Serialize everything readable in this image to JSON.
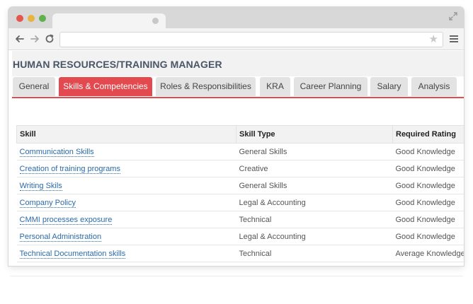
{
  "page": {
    "title": "HUMAN RESOURCES/TRAINING MANAGER"
  },
  "tabs": [
    {
      "label": "General"
    },
    {
      "label": "Skills & Competencies"
    },
    {
      "label": "Roles & Responsibilities"
    },
    {
      "label": "KRA"
    },
    {
      "label": "Career Planning"
    },
    {
      "label": "Salary"
    },
    {
      "label": "Analysis"
    }
  ],
  "active_tab": "Skills & Competencies",
  "table": {
    "headers": [
      "Skill",
      "Skill Type",
      "Required Rating"
    ],
    "rows": [
      [
        "Communication Skills",
        "General Skills",
        "Good Knowledge"
      ],
      [
        "Creation of training programs",
        "Creative",
        "Good Knowledge"
      ],
      [
        "Writing Skils",
        "General Skills",
        "Good Knowledge"
      ],
      [
        "Company Policy",
        "Legal & Accounting",
        "Good Knowledge"
      ],
      [
        "CMMI processes exposure",
        "Technical",
        "Good Knowledge"
      ],
      [
        "Personal Administration",
        "Legal & Accounting",
        "Good Knowledge"
      ],
      [
        "Technical Documentation skills",
        "Technical",
        "Average Knowledge"
      ]
    ]
  },
  "colors": {
    "accent": "#e24a4f",
    "link": "#2c6aa8",
    "title": "#4a5566"
  },
  "icons": [
    "back-arrow-icon",
    "forward-arrow-icon",
    "reload-icon",
    "star-icon",
    "menu-icon",
    "expand-icon"
  ]
}
